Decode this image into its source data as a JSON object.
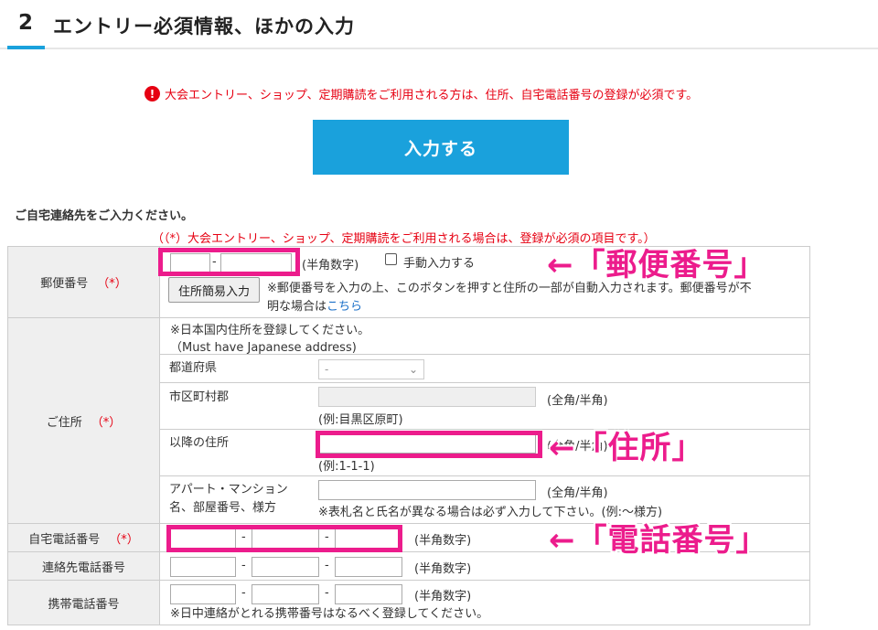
{
  "section": {
    "number": "2",
    "title": "エントリー必須情報、ほかの入力"
  },
  "notice": {
    "icon": "!",
    "text": "大会エントリー、ショップ、定期購読をご利用される方は、住所、自宅電話番号の登録が必須です。"
  },
  "enter_button": "入力する",
  "contact_heading": "ご自宅連絡先をご入力ください。",
  "required_note": "（（*）大会エントリー、ショップ、定期購読をご利用される場合は、登録が必須の項目です。）",
  "required_mark": "（*）",
  "postal": {
    "label": "郵便番号",
    "dash": "-",
    "hint": "(半角数字)",
    "manual_label": "手動入力する",
    "lookup_button": "住所簡易入力",
    "help_line1": "※郵便番号を入力の上、このボタンを押すと住所の一部が自動入力されます。郵便番号が不",
    "help_line2": "明な場合は",
    "help_link": "こちら"
  },
  "address": {
    "label": "ご住所",
    "note_line1": "※日本国内住所を登録してください。",
    "note_line2": "（Must have Japanese address)",
    "prefecture_label": "都道府県",
    "prefecture_value": "-",
    "city_label": "市区町村郡",
    "city_hint": "(全角/半角)",
    "city_example": "(例:目黒区原町)",
    "street_label": "以降の住所",
    "street_hint": "(全角/半角)",
    "street_example": "(例:1-1-1)",
    "building_label_line1": "アパート・マンション",
    "building_label_line2": "名、部屋番号、様方",
    "building_hint": "(全角/半角)",
    "building_note": "※表札名と氏名が異なる場合は必ず入力して下さい。(例:～様方)"
  },
  "home_phone": {
    "label": "自宅電話番号",
    "hint": "(半角数字)"
  },
  "contact_phone": {
    "label": "連絡先電話番号",
    "hint": "(半角数字)"
  },
  "mobile_phone": {
    "label": "携帯電話番号",
    "hint": "(半角数字)",
    "note": "※日中連絡がとれる携帯番号はなるべく登録してください。"
  },
  "annotations": {
    "postal": "←「郵便番号」",
    "address": "←「住所」",
    "phone": "←「電話番号」"
  },
  "colors": {
    "accent": "#1aa1dc",
    "required": "#e60012",
    "highlight": "#ec1c8c"
  }
}
